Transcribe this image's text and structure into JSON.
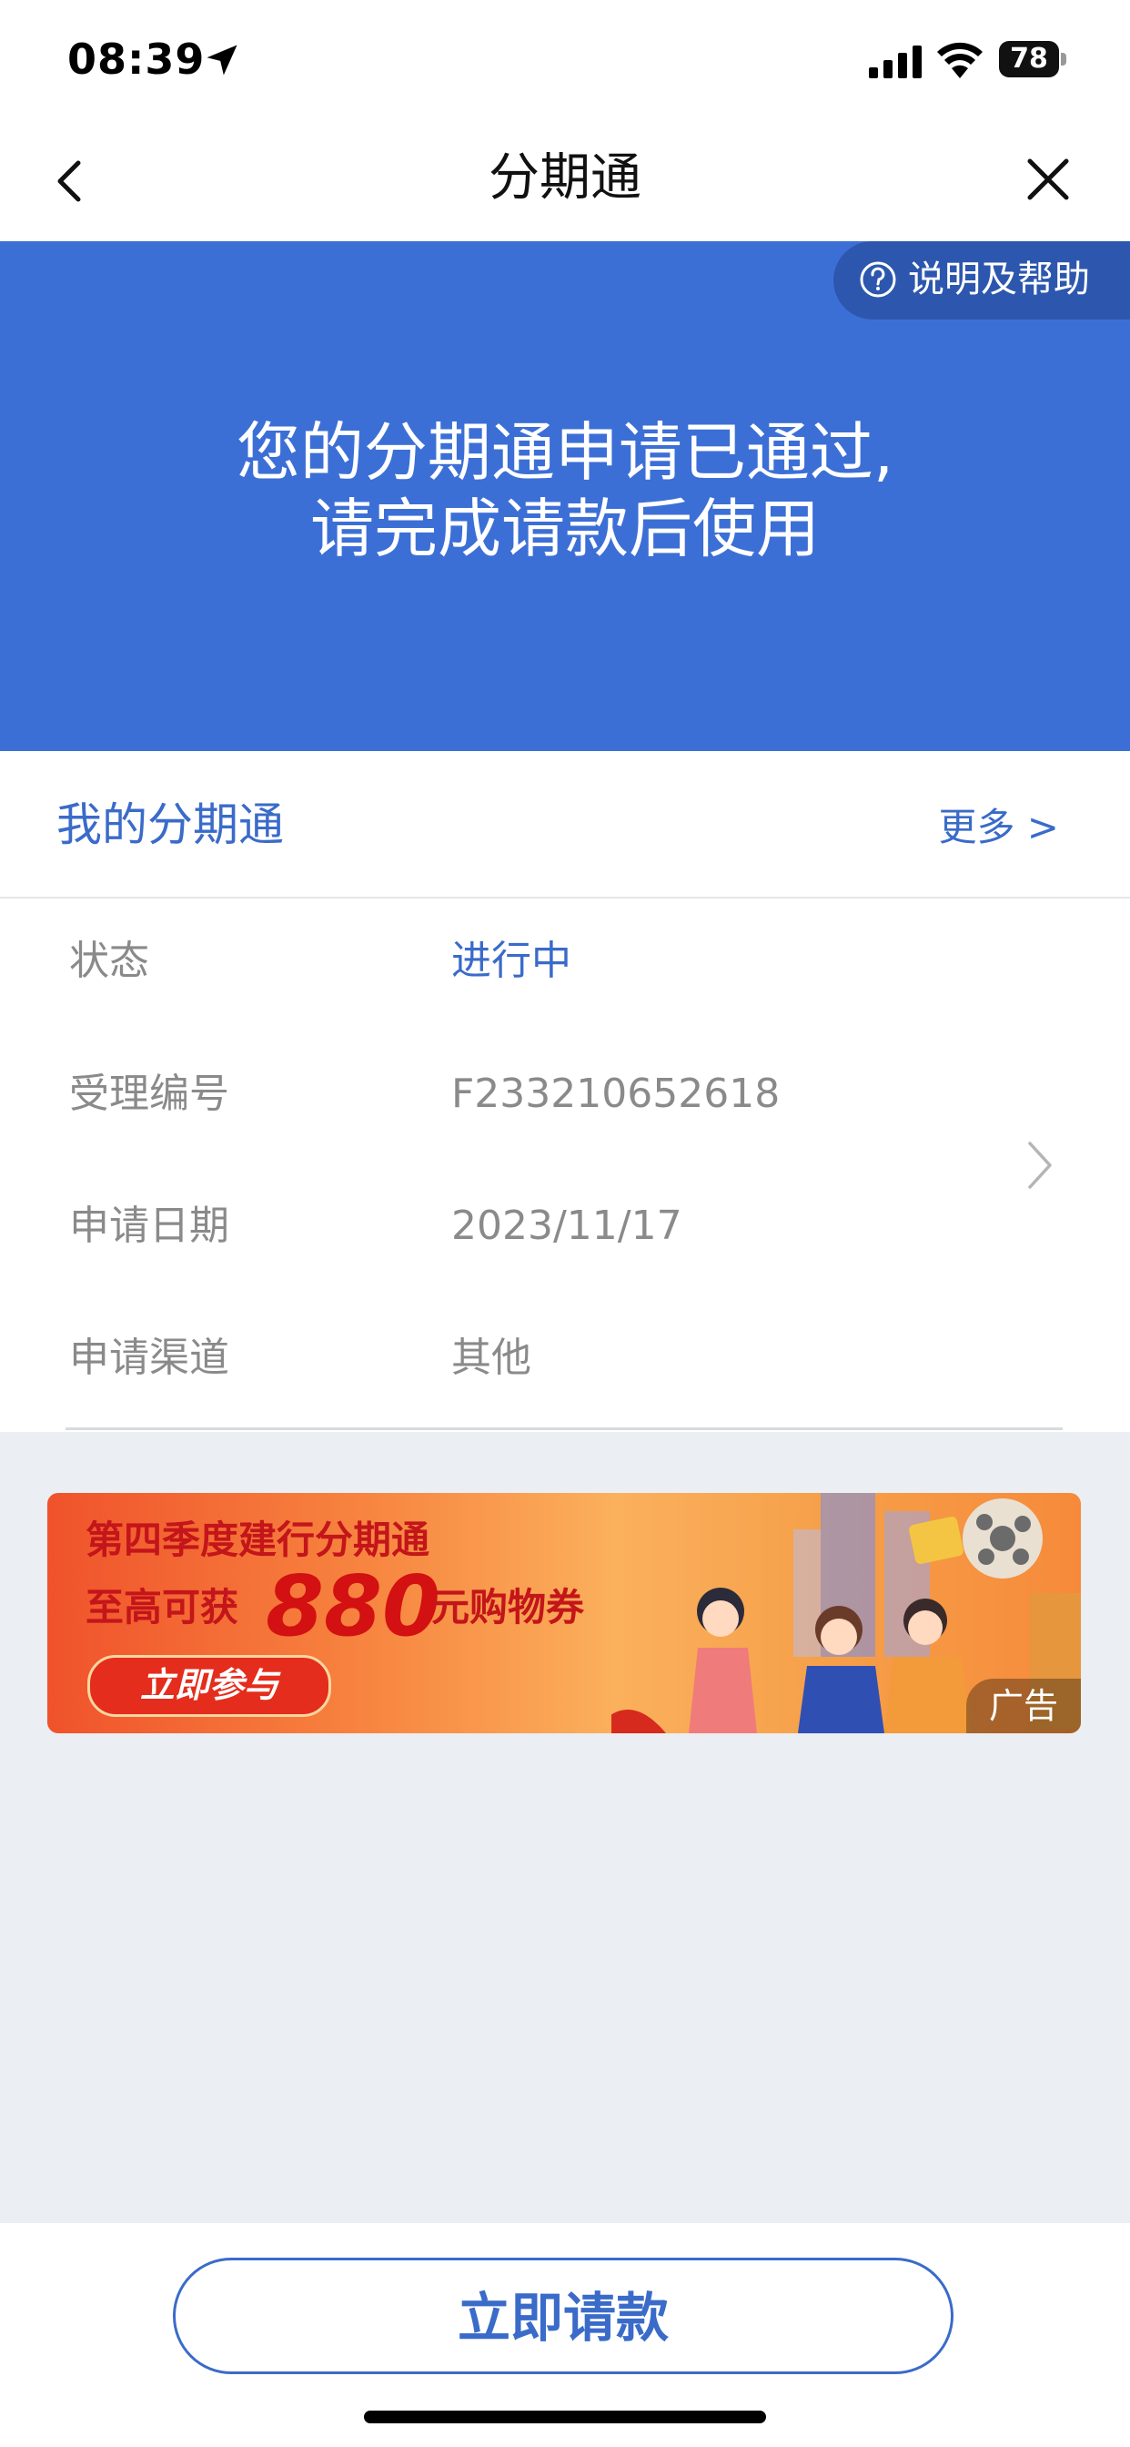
{
  "status_bar": {
    "time": "08:39",
    "battery": "78"
  },
  "nav": {
    "title": "分期通"
  },
  "hero": {
    "help_label": "说明及帮助",
    "message_line1": "您的分期通申请已通过,",
    "message_line2": "请完成请款后使用"
  },
  "card": {
    "title": "我的分期通",
    "more": "更多 >",
    "rows": [
      {
        "label": "状态",
        "value": "进行中"
      },
      {
        "label": "受理编号",
        "value": "F233210652618"
      },
      {
        "label": "申请日期",
        "value": "2023/11/17"
      },
      {
        "label": "申请渠道",
        "value": "其他"
      }
    ]
  },
  "ad": {
    "line1": "第四季度建行分期通",
    "line2_prefix": "至高可获",
    "amount": "880",
    "line2_suffix": "元购物券",
    "cta": "立即参与",
    "tag": "广告"
  },
  "bottom": {
    "apply_label": "立即请款"
  },
  "colors": {
    "primary": "#3c6fd6",
    "link": "#3a6bc9",
    "background": "#ebeef2"
  }
}
